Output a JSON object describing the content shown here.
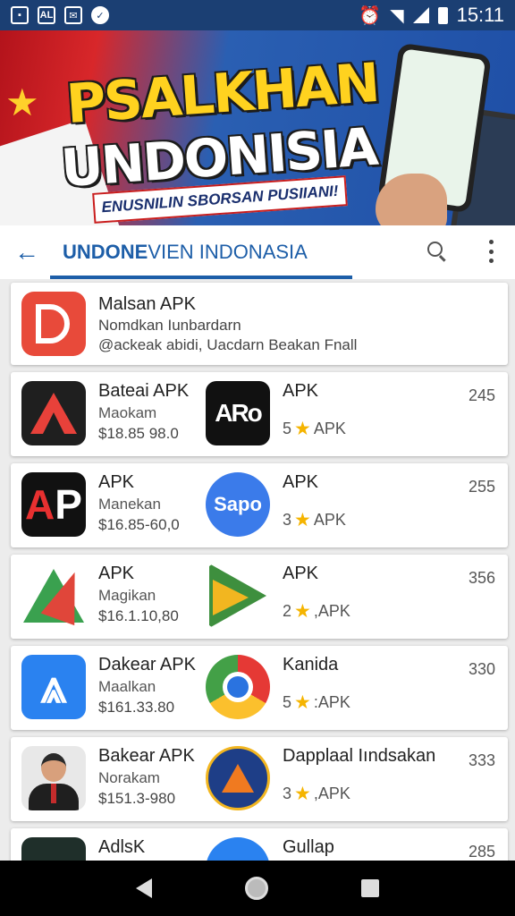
{
  "status_bar": {
    "left_icons": [
      "image-icon",
      "al-badge",
      "mail-icon",
      "check-icon"
    ],
    "al_text": "AL",
    "time": "15:11"
  },
  "banner": {
    "title_line1": "PSALKHAN",
    "title_line2": "UNDONISIA",
    "ribbon": "ENUSNILIN SBORSAN PUSIIANI!"
  },
  "app_bar": {
    "title_bold": "UNDONE",
    "title_rest": "VIEN INDONASIA"
  },
  "featured": {
    "name": "Malsan APK",
    "subtitle": "Nomdkan Iunbardarn",
    "description": "@ackeak abidi, Uacdarn Beakan Fnall"
  },
  "rows": [
    {
      "left": {
        "name": "Bateai APK",
        "sub": "Maokam",
        "price": "$18.85 98.0"
      },
      "right": {
        "name": "APK",
        "rating": "5",
        "label": "APK"
      },
      "count": "245"
    },
    {
      "left": {
        "name": "APK",
        "sub": "Manekan",
        "price": "$16.85-60,0"
      },
      "right": {
        "name": "APK",
        "rating": "3",
        "label": "APK",
        "icon_text": "Sapo"
      },
      "count": "255"
    },
    {
      "left": {
        "name": "APK",
        "sub": "Magikan",
        "price": "$16.1.10,80"
      },
      "right": {
        "name": "APK",
        "rating": "2",
        "label": ",APK"
      },
      "count": "356"
    },
    {
      "left": {
        "name": "Dakear APK",
        "sub": "Maalkan",
        "price": "$161.33.80"
      },
      "right": {
        "name": "Kanida",
        "rating": "5",
        "label": ":APK"
      },
      "count": "330"
    },
    {
      "left": {
        "name": "Bakear APK",
        "sub": "Norakam",
        "price": "$151.3-980"
      },
      "right": {
        "name": "Dapplaal Iındsakan",
        "rating": "3",
        "label": ",APK"
      },
      "count": "333"
    },
    {
      "left": {
        "name": "AdlsK",
        "sub": "",
        "price": ""
      },
      "right": {
        "name": "Gullap",
        "rating": "",
        "label": ""
      },
      "count": "285"
    }
  ],
  "icons": {
    "aro_text": "ARo",
    "ap_text_a": "A",
    "ap_text_p": "P"
  },
  "colors": {
    "status_bar": "#1b3f73",
    "accent": "#1d5ea8",
    "star": "#f5b400"
  }
}
